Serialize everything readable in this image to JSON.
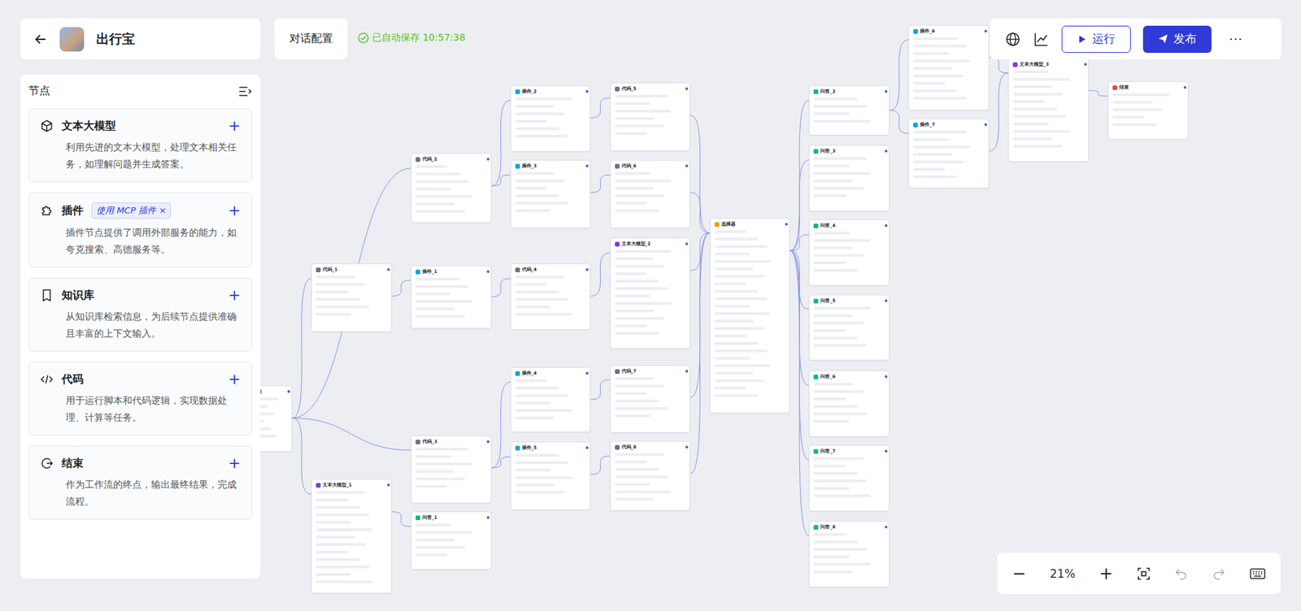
{
  "header": {
    "title": "出行宝",
    "tab": "对话配置",
    "save_status": "已自动保存 10:57:38"
  },
  "toolbar": {
    "run": "运行",
    "publish": "发布",
    "more": "···"
  },
  "sidebar": {
    "title": "节点",
    "items": [
      {
        "title": "文本大模型",
        "desc": "利用先进的文本大模型，处理文本相关任务，如理解问题并生成答案。",
        "kind": "llm",
        "badge": "",
        "add": "+"
      },
      {
        "title": "插件",
        "desc": "插件节点提供了调用外部服务的能力，如夸克搜索、高德服务等。",
        "kind": "plugin",
        "badge": "使用 MCP 插件",
        "add": "+"
      },
      {
        "title": "知识库",
        "desc": "从知识库检索信息，为后续节点提供准确且丰富的上下文输入。",
        "kind": "kb",
        "badge": "",
        "add": "+"
      },
      {
        "title": "代码",
        "desc": "用于运行脚本和代码逻辑，实现数据处理、计算等任务。",
        "kind": "code",
        "badge": "",
        "add": "+"
      },
      {
        "title": "结束",
        "desc": "作为工作流的终点，输出最终结果，完成流程。",
        "kind": "end",
        "badge": "",
        "add": "+"
      }
    ],
    "badge_close": "×"
  },
  "zoom": {
    "minus": "−",
    "level": "21%",
    "plus": "+"
  },
  "nodes": [
    {
      "title": "开始",
      "kind": "start"
    },
    {
      "title": "代码_1",
      "kind": "code"
    },
    {
      "title": "文本大模型_1",
      "kind": "llm"
    },
    {
      "title": "代码_2",
      "kind": "code"
    },
    {
      "title": "插件_1",
      "kind": "plugin"
    },
    {
      "title": "代码_3",
      "kind": "code"
    },
    {
      "title": "问答_1",
      "kind": "qa"
    },
    {
      "title": "插件_2",
      "kind": "plugin"
    },
    {
      "title": "插件_3",
      "kind": "plugin"
    },
    {
      "title": "代码_4",
      "kind": "code"
    },
    {
      "title": "插件_4",
      "kind": "plugin"
    },
    {
      "title": "插件_5",
      "kind": "plugin"
    },
    {
      "title": "代码_5",
      "kind": "code"
    },
    {
      "title": "代码_6",
      "kind": "code"
    },
    {
      "title": "文本大模型_2",
      "kind": "llm"
    },
    {
      "title": "代码_7",
      "kind": "code"
    },
    {
      "title": "代码_8",
      "kind": "code"
    },
    {
      "title": "选择器",
      "kind": "selector"
    },
    {
      "title": "问答_2",
      "kind": "qa"
    },
    {
      "title": "问答_3",
      "kind": "qa"
    },
    {
      "title": "问答_4",
      "kind": "qa"
    },
    {
      "title": "问答_5",
      "kind": "qa"
    },
    {
      "title": "问答_6",
      "kind": "qa"
    },
    {
      "title": "问答_7",
      "kind": "qa"
    },
    {
      "title": "问答_8",
      "kind": "qa"
    },
    {
      "title": "插件_6",
      "kind": "plugin"
    },
    {
      "title": "插件_7",
      "kind": "plugin"
    },
    {
      "title": "文本大模型_3",
      "kind": "llm"
    },
    {
      "title": "结束",
      "kind": "end"
    }
  ],
  "edges": [
    [
      0,
      1
    ],
    [
      0,
      3
    ],
    [
      0,
      2
    ],
    [
      0,
      5
    ],
    [
      1,
      4
    ],
    [
      3,
      7
    ],
    [
      3,
      8
    ],
    [
      4,
      9
    ],
    [
      5,
      10
    ],
    [
      5,
      11
    ],
    [
      2,
      6
    ],
    [
      7,
      12
    ],
    [
      8,
      13
    ],
    [
      9,
      14
    ],
    [
      10,
      15
    ],
    [
      11,
      16
    ],
    [
      12,
      17
    ],
    [
      13,
      17
    ],
    [
      14,
      17
    ],
    [
      15,
      17
    ],
    [
      16,
      17
    ],
    [
      17,
      18
    ],
    [
      17,
      19
    ],
    [
      17,
      20
    ],
    [
      17,
      21
    ],
    [
      17,
      22
    ],
    [
      17,
      23
    ],
    [
      17,
      24
    ],
    [
      18,
      25
    ],
    [
      18,
      26
    ],
    [
      25,
      27
    ],
    [
      26,
      27
    ],
    [
      27,
      28
    ]
  ]
}
